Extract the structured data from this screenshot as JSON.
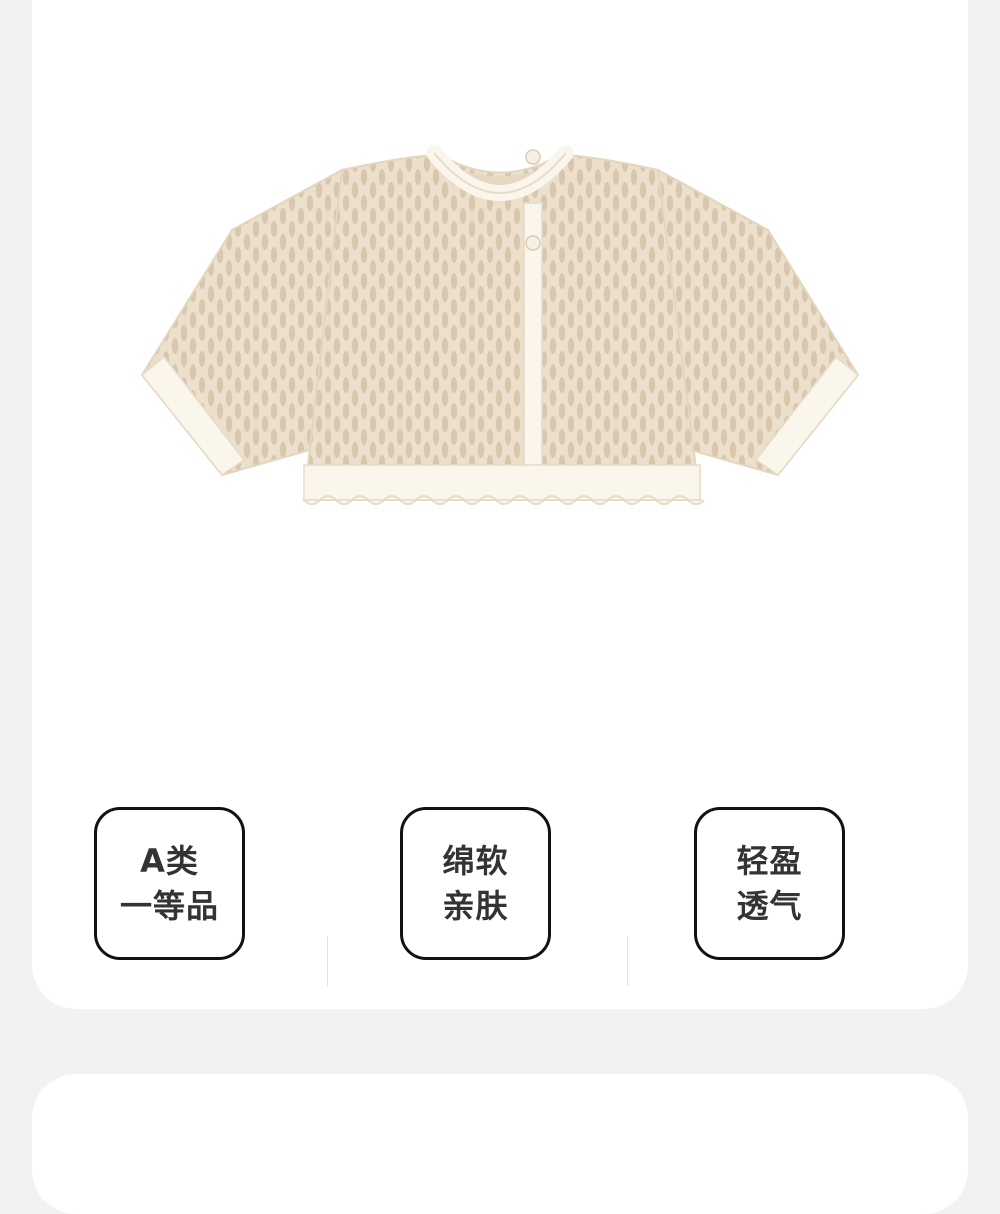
{
  "features": [
    {
      "line1": "A类",
      "line2": "一等品"
    },
    {
      "line1": "绵软",
      "line2": "亲肤"
    },
    {
      "line1": "轻盈",
      "line2": "透气"
    }
  ],
  "colors": {
    "page_background": "#f2f2f2",
    "card_background": "#ffffff",
    "badge_border": "#111111",
    "badge_text": "#333333",
    "garment_body": "#eee2cf",
    "garment_trim": "#faf6ec"
  },
  "icons": {
    "product": "knit-cardigan-image"
  }
}
